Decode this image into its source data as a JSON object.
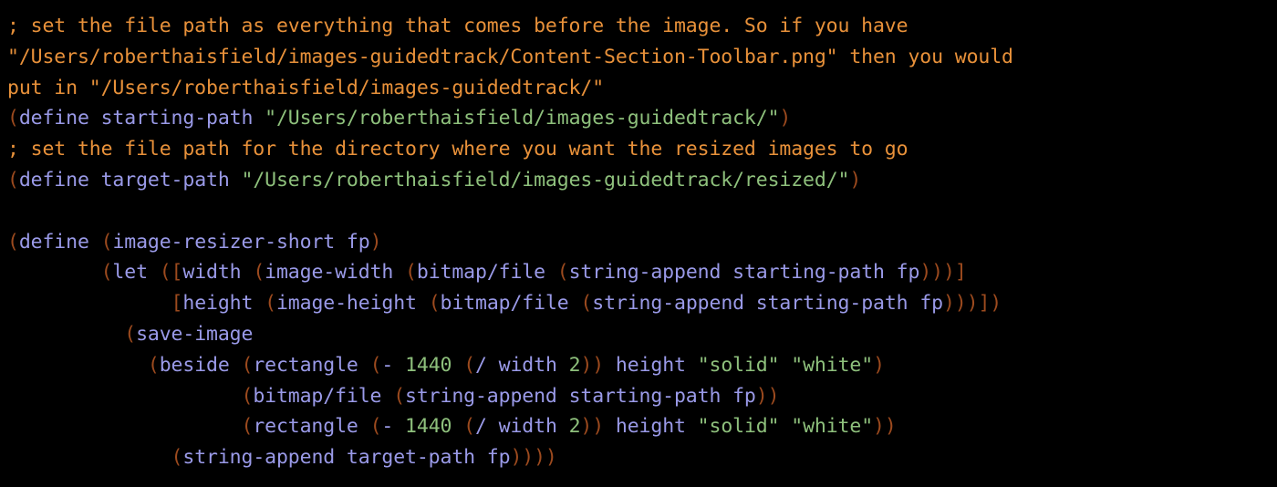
{
  "editor": {
    "language": "Racket",
    "background_color": "#000000",
    "colors": {
      "comment": "#e8913a",
      "paren": "#9c4a1e",
      "bracket": "#9c4a1e",
      "symbol": "#9a9ae8",
      "string": "#8ec07c",
      "number": "#8ec07c"
    },
    "lines": [
      {
        "n": 1,
        "text": "; set the file path as everything that comes before the image. So if you have",
        "tokens": [
          {
            "t": "; set the file path as everything that comes before the image. So if you have",
            "c": "comment"
          }
        ]
      },
      {
        "n": 2,
        "text": "\"/Users/roberthaisfield/images-guidedtrack/Content-Section-Toolbar.png\" then you would",
        "tokens": [
          {
            "t": "\"/Users/roberthaisfield/images-guidedtrack/Content-Section-Toolbar.png\" then you would",
            "c": "comment"
          }
        ]
      },
      {
        "n": 3,
        "text": "put in \"/Users/roberthaisfield/images-guidedtrack/\"",
        "tokens": [
          {
            "t": "put in \"/Users/roberthaisfield/images-guidedtrack/\"",
            "c": "comment"
          }
        ]
      },
      {
        "n": 4,
        "text": "(define starting-path \"/Users/roberthaisfield/images-guidedtrack/\")",
        "tokens": [
          {
            "t": "(",
            "c": "paren"
          },
          {
            "t": "define starting-path ",
            "c": "symbol"
          },
          {
            "t": "\"/Users/roberthaisfield/images-guidedtrack/\"",
            "c": "string"
          },
          {
            "t": ")",
            "c": "paren"
          }
        ]
      },
      {
        "n": 5,
        "text": "; set the file path for the directory where you want the resized images to go",
        "tokens": [
          {
            "t": "; set the file path for the directory where you want the resized images to go",
            "c": "comment"
          }
        ]
      },
      {
        "n": 6,
        "text": "(define target-path \"/Users/roberthaisfield/images-guidedtrack/resized/\")",
        "tokens": [
          {
            "t": "(",
            "c": "paren"
          },
          {
            "t": "define target-path ",
            "c": "symbol"
          },
          {
            "t": "\"/Users/roberthaisfield/images-guidedtrack/resized/\"",
            "c": "string"
          },
          {
            "t": ")",
            "c": "paren"
          }
        ]
      },
      {
        "n": 7,
        "text": "",
        "tokens": []
      },
      {
        "n": 8,
        "text": "(define (image-resizer-short fp)",
        "tokens": [
          {
            "t": "(",
            "c": "paren"
          },
          {
            "t": "define ",
            "c": "symbol"
          },
          {
            "t": "(",
            "c": "paren"
          },
          {
            "t": "image-resizer-short fp",
            "c": "symbol"
          },
          {
            "t": ")",
            "c": "paren"
          }
        ]
      },
      {
        "n": 9,
        "text": "        (let ([width (image-width (bitmap/file (string-append starting-path fp)))]",
        "tokens": [
          {
            "t": "        ",
            "c": "plain"
          },
          {
            "t": "(",
            "c": "paren"
          },
          {
            "t": "let ",
            "c": "symbol"
          },
          {
            "t": "(",
            "c": "paren"
          },
          {
            "t": "[",
            "c": "bracket"
          },
          {
            "t": "width ",
            "c": "symbol"
          },
          {
            "t": "(",
            "c": "paren"
          },
          {
            "t": "image-width ",
            "c": "symbol"
          },
          {
            "t": "(",
            "c": "paren"
          },
          {
            "t": "bitmap/file ",
            "c": "symbol"
          },
          {
            "t": "(",
            "c": "paren"
          },
          {
            "t": "string-append starting-path fp",
            "c": "symbol"
          },
          {
            "t": ")))",
            "c": "paren"
          },
          {
            "t": "]",
            "c": "bracket"
          }
        ]
      },
      {
        "n": 10,
        "text": "              [height (image-height (bitmap/file (string-append starting-path fp)))])",
        "tokens": [
          {
            "t": "              ",
            "c": "plain"
          },
          {
            "t": "[",
            "c": "bracket"
          },
          {
            "t": "height ",
            "c": "symbol"
          },
          {
            "t": "(",
            "c": "paren"
          },
          {
            "t": "image-height ",
            "c": "symbol"
          },
          {
            "t": "(",
            "c": "paren"
          },
          {
            "t": "bitmap/file ",
            "c": "symbol"
          },
          {
            "t": "(",
            "c": "paren"
          },
          {
            "t": "string-append starting-path fp",
            "c": "symbol"
          },
          {
            "t": ")))",
            "c": "paren"
          },
          {
            "t": "]",
            "c": "bracket"
          },
          {
            "t": ")",
            "c": "paren"
          }
        ]
      },
      {
        "n": 11,
        "text": "          (save-image",
        "tokens": [
          {
            "t": "          ",
            "c": "plain"
          },
          {
            "t": "(",
            "c": "paren"
          },
          {
            "t": "save-image",
            "c": "symbol"
          }
        ]
      },
      {
        "n": 12,
        "text": "            (beside (rectangle (- 1440 (/ width 2)) height \"solid\" \"white\")",
        "tokens": [
          {
            "t": "            ",
            "c": "plain"
          },
          {
            "t": "(",
            "c": "paren"
          },
          {
            "t": "beside ",
            "c": "symbol"
          },
          {
            "t": "(",
            "c": "paren"
          },
          {
            "t": "rectangle ",
            "c": "symbol"
          },
          {
            "t": "(",
            "c": "paren"
          },
          {
            "t": "- ",
            "c": "symbol"
          },
          {
            "t": "1440 ",
            "c": "number"
          },
          {
            "t": "(",
            "c": "paren"
          },
          {
            "t": "/ width ",
            "c": "symbol"
          },
          {
            "t": "2",
            "c": "number"
          },
          {
            "t": "))",
            "c": "paren"
          },
          {
            "t": " height ",
            "c": "symbol"
          },
          {
            "t": "\"solid\" \"white\"",
            "c": "string"
          },
          {
            "t": ")",
            "c": "paren"
          }
        ]
      },
      {
        "n": 13,
        "text": "                    (bitmap/file (string-append starting-path fp))",
        "tokens": [
          {
            "t": "                    ",
            "c": "plain"
          },
          {
            "t": "(",
            "c": "paren"
          },
          {
            "t": "bitmap/file ",
            "c": "symbol"
          },
          {
            "t": "(",
            "c": "paren"
          },
          {
            "t": "string-append starting-path fp",
            "c": "symbol"
          },
          {
            "t": "))",
            "c": "paren"
          }
        ]
      },
      {
        "n": 14,
        "text": "                    (rectangle (- 1440 (/ width 2)) height \"solid\" \"white\"))",
        "tokens": [
          {
            "t": "                    ",
            "c": "plain"
          },
          {
            "t": "(",
            "c": "paren"
          },
          {
            "t": "rectangle ",
            "c": "symbol"
          },
          {
            "t": "(",
            "c": "paren"
          },
          {
            "t": "- ",
            "c": "symbol"
          },
          {
            "t": "1440 ",
            "c": "number"
          },
          {
            "t": "(",
            "c": "paren"
          },
          {
            "t": "/ width ",
            "c": "symbol"
          },
          {
            "t": "2",
            "c": "number"
          },
          {
            "t": "))",
            "c": "paren"
          },
          {
            "t": " height ",
            "c": "symbol"
          },
          {
            "t": "\"solid\" \"white\"",
            "c": "string"
          },
          {
            "t": "))",
            "c": "paren"
          }
        ]
      },
      {
        "n": 15,
        "text": "              (string-append target-path fp))))",
        "tokens": [
          {
            "t": "              ",
            "c": "plain"
          },
          {
            "t": "(",
            "c": "paren"
          },
          {
            "t": "string-append target-path fp",
            "c": "symbol"
          },
          {
            "t": "))))",
            "c": "paren"
          }
        ]
      }
    ]
  }
}
